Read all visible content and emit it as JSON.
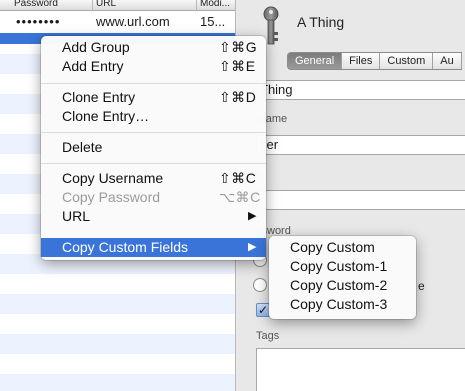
{
  "table": {
    "columns": [
      "Password",
      "URL",
      "Modi..."
    ],
    "entry": {
      "password": "••••••••",
      "url": "www.url.com",
      "modified": "15..."
    }
  },
  "detail": {
    "title": "A Thing",
    "tabs": [
      {
        "label": "General",
        "active": true
      },
      {
        "label": "Files",
        "active": false
      },
      {
        "label": "Custom",
        "active": false
      },
      {
        "label": "Au",
        "active": false
      }
    ],
    "title_field": "Thing",
    "username_label": "rname",
    "username_field": "ser",
    "url_label": "L",
    "password_label": "ssword",
    "option_text": "e",
    "checkbox_mark": "✓",
    "tags_label": "Tags"
  },
  "context_menu": {
    "items": [
      {
        "label": "Add Group",
        "shortcut": "⇧⌘G"
      },
      {
        "label": "Add Entry",
        "shortcut": "⇧⌘E"
      },
      {
        "label": "Clone Entry",
        "shortcut": "⇧⌘D"
      },
      {
        "label": "Clone Entry…",
        "shortcut": ""
      },
      {
        "label": "Delete",
        "shortcut": ""
      },
      {
        "label": "Copy Username",
        "shortcut": "⇧⌘C"
      },
      {
        "label": "Copy Password",
        "shortcut": "⌥⌘C",
        "disabled": true
      },
      {
        "label": "URL",
        "submenu": true
      },
      {
        "label": "Copy Custom Fields",
        "submenu": true,
        "highlighted": true
      }
    ],
    "arrow": "▶"
  },
  "submenu": {
    "items": [
      "Copy Custom",
      "Copy Custom-1",
      "Copy Custom-2",
      "Copy Custom-3"
    ]
  },
  "colors": {
    "selection": "#3875d7",
    "menu_highlight": "#3a74d9",
    "stripe": "#edf3fe"
  }
}
